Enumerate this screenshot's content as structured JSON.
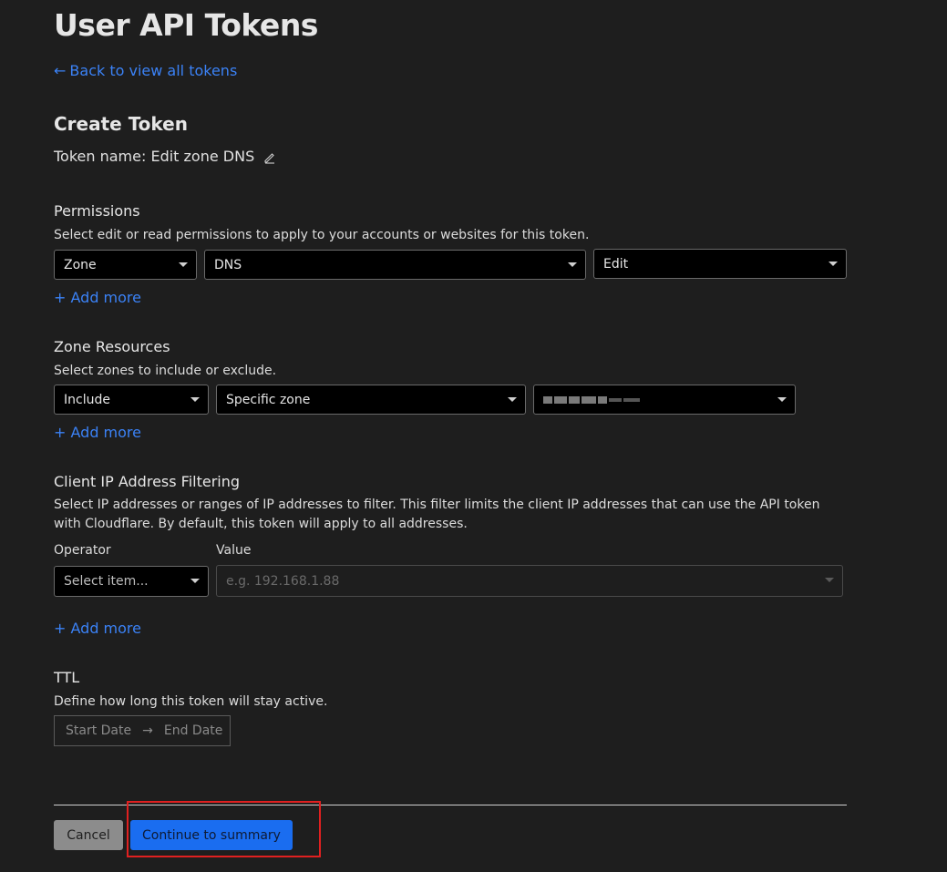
{
  "page_title": "User API Tokens",
  "back_link": {
    "arrow": "←",
    "label": "Back to view all tokens"
  },
  "create_token": {
    "heading": "Create Token",
    "token_name": "Token name: Edit zone DNS"
  },
  "permissions": {
    "heading": "Permissions",
    "description": "Select edit or read permissions to apply to your accounts or websites for this token.",
    "selects": [
      "Zone",
      "DNS",
      "Edit"
    ],
    "add_more": "+ Add more"
  },
  "zone_resources": {
    "heading": "Zone Resources",
    "description": "Select zones to include or exclude.",
    "selects": [
      "Include",
      "Specific zone"
    ],
    "add_more": "+ Add more"
  },
  "ip_filtering": {
    "heading": "Client IP Address Filtering",
    "description": "Select IP addresses or ranges of IP addresses to filter. This filter limits the client IP addresses that can use the API token with Cloudflare. By default, this token will apply to all addresses.",
    "operator_label": "Operator",
    "value_label": "Value",
    "operator_placeholder": "Select item...",
    "value_placeholder": "e.g. 192.168.1.88",
    "add_more": "+ Add more"
  },
  "ttl": {
    "heading": "TTL",
    "description": "Define how long this token will stay active.",
    "start_date": "Start Date",
    "arrow": "→",
    "end_date": "End Date"
  },
  "footer": {
    "cancel_label": "Cancel",
    "continue_label": "Continue to summary"
  },
  "colors": {
    "background": "#1e1e1e",
    "link": "#3b82f6",
    "primary_button": "#1a6df0",
    "highlight": "#e02020"
  }
}
